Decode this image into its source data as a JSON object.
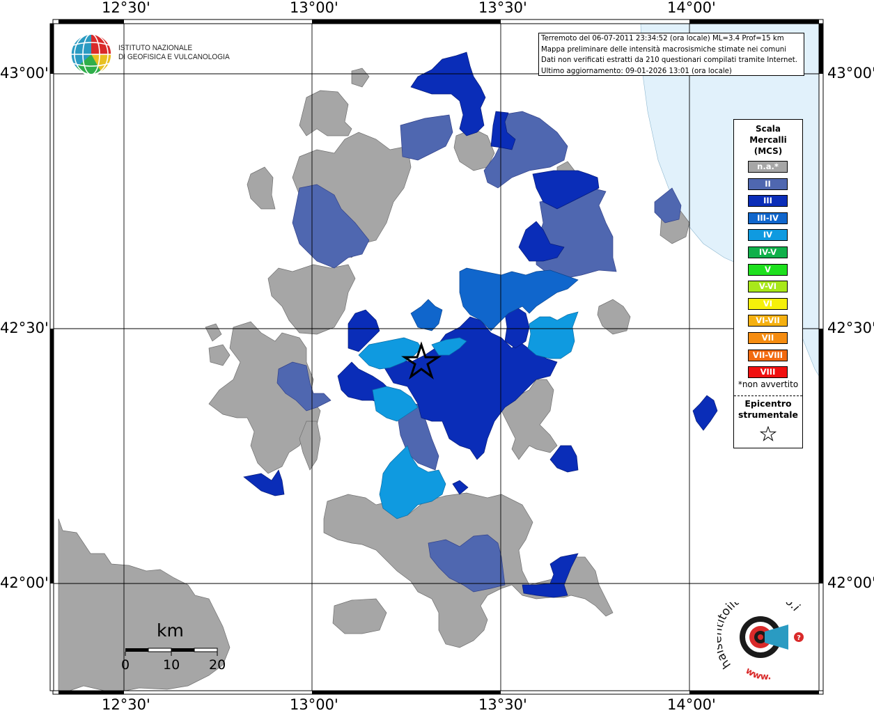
{
  "coords": {
    "lon_top": [
      "12°30'",
      "13°00'",
      "13°30'",
      "14°00'"
    ],
    "lon_bottom": [
      "12°30'",
      "13°00'",
      "13°30'",
      "14°00'"
    ],
    "lat_left": [
      "43°00'",
      "42°30'",
      "42°00'"
    ],
    "lat_right": [
      "43°00'",
      "42°30'",
      "42°00'"
    ]
  },
  "header": {
    "line1": "Terremoto del 06-07-2011 23:34:52 (ora locale) ML=3.4 Prof=15 km",
    "line2": "Mappa preliminare delle intensità macrosismiche stimate nei comuni",
    "line3": "Dati non verificati estratti da 210 questionari compilati tramite Internet.",
    "line4": "Ultimo aggiornamento: 09-01-2026 13:01 (ora locale)"
  },
  "logo": {
    "line1": "ISTITUTO NAZIONALE",
    "line2": "DI GEOFISICA E VULCANOLOGIA"
  },
  "legend": {
    "title1": "Scala",
    "title2": "Mercalli",
    "title3": "(MCS)",
    "items": [
      {
        "label": "n.a.*",
        "color": "#a6a6a6"
      },
      {
        "label": "II",
        "color": "#4f67b0"
      },
      {
        "label": "III",
        "color": "#0a2db8"
      },
      {
        "label": "III-IV",
        "color": "#1066cc"
      },
      {
        "label": "IV",
        "color": "#0f9ae0"
      },
      {
        "label": "IV-V",
        "color": "#10b04a"
      },
      {
        "label": "V",
        "color": "#1ee01e"
      },
      {
        "label": "V-VI",
        "color": "#a8e81a"
      },
      {
        "label": "VI",
        "color": "#f5f00a"
      },
      {
        "label": "VI-VII",
        "color": "#f5b010"
      },
      {
        "label": "VII",
        "color": "#f58c10"
      },
      {
        "label": "VII-VIII",
        "color": "#f26a10"
      },
      {
        "label": "VIII",
        "color": "#f01010"
      }
    ],
    "na_note": "*non avvertito",
    "epicentre1": "Epicentro",
    "epicentre2": "strumentale"
  },
  "scale": {
    "unit": "km",
    "ticks": [
      "0",
      "10",
      "20"
    ]
  },
  "site": {
    "text": "haisentitoilterremoto.it",
    "prefix": "www."
  },
  "colors": {
    "sea": "#e1f1fb",
    "grey": "#a6a6a6",
    "II": "#4f67b0",
    "III": "#0a2db8",
    "III_IV": "#1066cc",
    "IV": "#0f9ae0"
  }
}
